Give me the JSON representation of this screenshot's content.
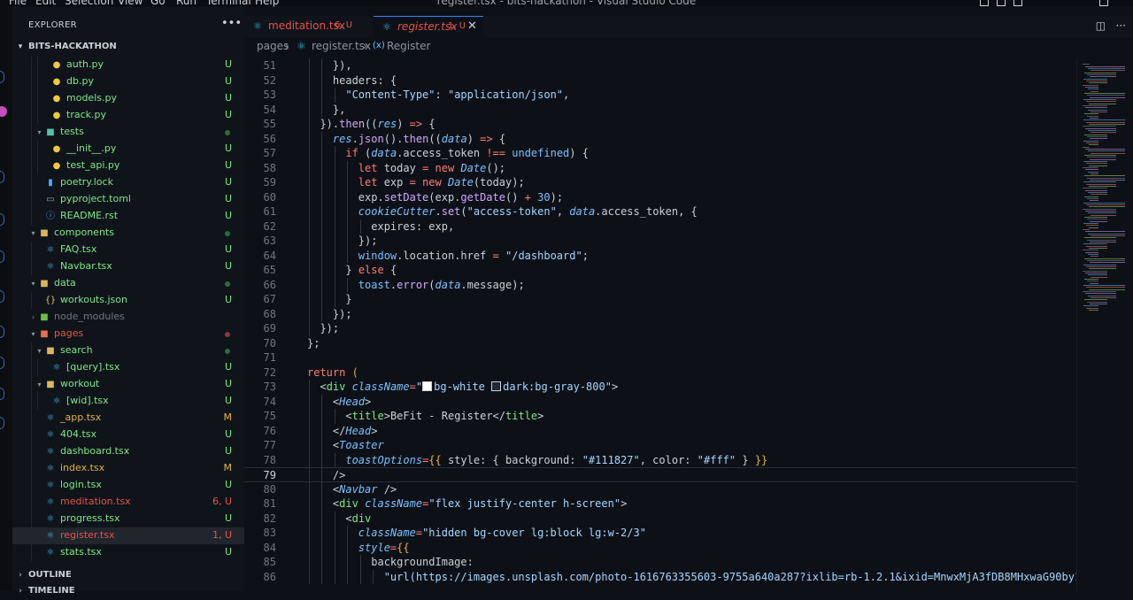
{
  "window": {
    "title": "register.tsx - bits-hackathon - Visual Studio Code",
    "menu": [
      "File",
      "Edit",
      "Selection",
      "View",
      "Go",
      "Run",
      "Terminal",
      "Help"
    ]
  },
  "activity": {
    "badge_color": "#c64ebc"
  },
  "sidebar": {
    "title": "EXPLORER",
    "more_icon": "ellipsis-icon",
    "root": "BITS-HACKATHON",
    "tree": [
      {
        "label": "auth.py",
        "icon": "python-icon",
        "depth": 3,
        "status": "U",
        "kind": "file"
      },
      {
        "label": "db.py",
        "icon": "python-icon",
        "depth": 3,
        "status": "U",
        "kind": "file"
      },
      {
        "label": "models.py",
        "icon": "python-icon",
        "depth": 3,
        "status": "U",
        "kind": "file"
      },
      {
        "label": "track.py",
        "icon": "python-icon",
        "depth": 3,
        "status": "U",
        "kind": "file"
      },
      {
        "label": "tests",
        "icon": "test-folder-icon",
        "depth": 2,
        "status": "dot",
        "kind": "folder-open"
      },
      {
        "label": "__init__.py",
        "icon": "python-icon",
        "depth": 3,
        "status": "U",
        "kind": "file"
      },
      {
        "label": "test_api.py",
        "icon": "python-icon",
        "depth": 3,
        "status": "U",
        "kind": "file"
      },
      {
        "label": "poetry.lock",
        "icon": "lock-icon",
        "depth": 2,
        "status": "U",
        "kind": "file"
      },
      {
        "label": "pyproject.toml",
        "icon": "toml-icon",
        "depth": 2,
        "status": "U",
        "kind": "file"
      },
      {
        "label": "README.rst",
        "icon": "info-icon",
        "depth": 2,
        "status": "U",
        "kind": "file"
      },
      {
        "label": "components",
        "icon": "folder-icon",
        "depth": 1,
        "status": "dot",
        "kind": "folder-open"
      },
      {
        "label": "FAQ.tsx",
        "icon": "react-icon",
        "depth": 2,
        "status": "U",
        "kind": "file"
      },
      {
        "label": "Navbar.tsx",
        "icon": "react-icon",
        "depth": 2,
        "status": "U",
        "kind": "file"
      },
      {
        "label": "data",
        "icon": "folder-icon",
        "depth": 1,
        "status": "dot",
        "kind": "folder-open"
      },
      {
        "label": "workouts.json",
        "icon": "json-icon",
        "depth": 2,
        "status": "U",
        "kind": "file"
      },
      {
        "label": "node_modules",
        "icon": "node-folder-icon",
        "depth": 1,
        "status": "",
        "kind": "folder-closed"
      },
      {
        "label": "pages",
        "icon": "pages-folder-icon",
        "depth": 1,
        "status": "dot-red",
        "kind": "folder-open"
      },
      {
        "label": "search",
        "icon": "folder-icon",
        "depth": 2,
        "status": "dot",
        "kind": "folder-open"
      },
      {
        "label": "[query].tsx",
        "icon": "react-icon",
        "depth": 3,
        "status": "U",
        "kind": "file"
      },
      {
        "label": "workout",
        "icon": "folder-icon",
        "depth": 2,
        "status": "U",
        "kind": "folder-open"
      },
      {
        "label": "[wid].tsx",
        "icon": "react-icon",
        "depth": 3,
        "status": "U",
        "kind": "file"
      },
      {
        "label": "_app.tsx",
        "icon": "react-icon",
        "depth": 2,
        "status": "M",
        "kind": "file"
      },
      {
        "label": "404.tsx",
        "icon": "react-icon",
        "depth": 2,
        "status": "U",
        "kind": "file"
      },
      {
        "label": "dashboard.tsx",
        "icon": "react-icon",
        "depth": 2,
        "status": "U",
        "kind": "file"
      },
      {
        "label": "index.tsx",
        "icon": "react-icon",
        "depth": 2,
        "status": "M",
        "kind": "file"
      },
      {
        "label": "login.tsx",
        "icon": "react-icon",
        "depth": 2,
        "status": "U",
        "kind": "file"
      },
      {
        "label": "meditation.tsx",
        "icon": "react-icon",
        "depth": 2,
        "status": "6, U",
        "kind": "file",
        "error": true
      },
      {
        "label": "progress.tsx",
        "icon": "react-icon",
        "depth": 2,
        "status": "U",
        "kind": "file"
      },
      {
        "label": "register.tsx",
        "icon": "react-icon",
        "depth": 2,
        "status": "1, U",
        "kind": "file",
        "error": true,
        "selected": true
      },
      {
        "label": "stats.tsx",
        "icon": "react-icon",
        "depth": 2,
        "status": "U",
        "kind": "file"
      }
    ],
    "outline": "OUTLINE",
    "timeline": "TIMELINE"
  },
  "tabs": [
    {
      "label": "meditation.tsx",
      "badge": "6, U",
      "active": false
    },
    {
      "label": "register.tsx",
      "badge": "1, U",
      "active": true
    }
  ],
  "breadcrumb": {
    "folder": "pages",
    "file": "register.tsx",
    "symbol": "Register",
    "sep": "›"
  },
  "code": {
    "current_line": 79,
    "lines": [
      {
        "n": 51,
        "indent": 2,
        "tokens": [
          [
            "p",
            "}),"
          ]
        ]
      },
      {
        "n": 52,
        "indent": 2,
        "tokens": [
          [
            "p",
            "headers: {"
          ]
        ]
      },
      {
        "n": 53,
        "indent": 3,
        "tokens": [
          [
            "s",
            "\"Content-Type\""
          ],
          [
            "p",
            ": "
          ],
          [
            "s",
            "\"application/json\""
          ],
          [
            "p",
            ","
          ]
        ]
      },
      {
        "n": 54,
        "indent": 2,
        "tokens": [
          [
            "p",
            "},"
          ]
        ]
      },
      {
        "n": 55,
        "indent": 1,
        "tokens": [
          [
            "p",
            "})."
          ],
          [
            "f",
            "then"
          ],
          [
            "p",
            "(("
          ],
          [
            "i",
            "res"
          ],
          [
            "p",
            ") "
          ],
          [
            "k",
            "=>"
          ],
          [
            "p",
            " {"
          ]
        ]
      },
      {
        "n": 56,
        "indent": 2,
        "tokens": [
          [
            "i",
            "res"
          ],
          [
            "p",
            "."
          ],
          [
            "f",
            "json"
          ],
          [
            "p",
            "()."
          ],
          [
            "f",
            "then"
          ],
          [
            "p",
            "(("
          ],
          [
            "i",
            "data"
          ],
          [
            "p",
            ") "
          ],
          [
            "k",
            "=>"
          ],
          [
            "p",
            " {"
          ]
        ]
      },
      {
        "n": 57,
        "indent": 3,
        "tokens": [
          [
            "k",
            "if"
          ],
          [
            "p",
            " ("
          ],
          [
            "i",
            "data"
          ],
          [
            "p",
            ".access_token "
          ],
          [
            "k",
            "!=="
          ],
          [
            "p",
            " "
          ],
          [
            "n",
            "undefined"
          ],
          [
            "p",
            ") {"
          ]
        ]
      },
      {
        "n": 58,
        "indent": 4,
        "tokens": [
          [
            "k",
            "let"
          ],
          [
            "p",
            " today "
          ],
          [
            "k",
            "="
          ],
          [
            "p",
            " "
          ],
          [
            "k",
            "new"
          ],
          [
            "p",
            " "
          ],
          [
            "i",
            "Date"
          ],
          [
            "p",
            "();"
          ]
        ]
      },
      {
        "n": 59,
        "indent": 4,
        "tokens": [
          [
            "k",
            "let"
          ],
          [
            "p",
            " exp "
          ],
          [
            "k",
            "="
          ],
          [
            "p",
            " "
          ],
          [
            "k",
            "new"
          ],
          [
            "p",
            " "
          ],
          [
            "i",
            "Date"
          ],
          [
            "p",
            "(today);"
          ]
        ]
      },
      {
        "n": 60,
        "indent": 4,
        "tokens": [
          [
            "p",
            "exp."
          ],
          [
            "f",
            "setDate"
          ],
          [
            "p",
            "(exp."
          ],
          [
            "f",
            "getDate"
          ],
          [
            "p",
            "() "
          ],
          [
            "k",
            "+"
          ],
          [
            "p",
            " "
          ],
          [
            "n",
            "30"
          ],
          [
            "p",
            ");"
          ]
        ]
      },
      {
        "n": 61,
        "indent": 4,
        "tokens": [
          [
            "i",
            "cookieCutter"
          ],
          [
            "p",
            "."
          ],
          [
            "f",
            "set"
          ],
          [
            "p",
            "("
          ],
          [
            "s",
            "\"access-token\""
          ],
          [
            "p",
            ", "
          ],
          [
            "i",
            "data"
          ],
          [
            "p",
            ".access_token, {"
          ]
        ]
      },
      {
        "n": 62,
        "indent": 5,
        "tokens": [
          [
            "p",
            "expires: exp,"
          ]
        ]
      },
      {
        "n": 63,
        "indent": 4,
        "tokens": [
          [
            "p",
            "});"
          ]
        ]
      },
      {
        "n": 64,
        "indent": 4,
        "tokens": [
          [
            "n",
            "window"
          ],
          [
            "p",
            ".location.href "
          ],
          [
            "k",
            "="
          ],
          [
            "p",
            " "
          ],
          [
            "s",
            "\"/dashboard\""
          ],
          [
            "p",
            ";"
          ]
        ]
      },
      {
        "n": 65,
        "indent": 3,
        "tokens": [
          [
            "p",
            "} "
          ],
          [
            "k",
            "else"
          ],
          [
            "p",
            " {"
          ]
        ]
      },
      {
        "n": 66,
        "indent": 4,
        "tokens": [
          [
            "n",
            "toast"
          ],
          [
            "p",
            "."
          ],
          [
            "f",
            "error"
          ],
          [
            "p",
            "("
          ],
          [
            "i",
            "data"
          ],
          [
            "p",
            ".message);"
          ]
        ]
      },
      {
        "n": 67,
        "indent": 3,
        "tokens": [
          [
            "p",
            "}"
          ]
        ]
      },
      {
        "n": 68,
        "indent": 2,
        "tokens": [
          [
            "p",
            "});"
          ]
        ]
      },
      {
        "n": 69,
        "indent": 1,
        "tokens": [
          [
            "p",
            "});"
          ]
        ]
      },
      {
        "n": 70,
        "indent": 0,
        "tokens": [
          [
            "p",
            "};"
          ]
        ]
      },
      {
        "n": 71,
        "indent": 0,
        "tokens": []
      },
      {
        "n": 72,
        "indent": 0,
        "tokens": [
          [
            "k",
            "return"
          ],
          [
            "p",
            " "
          ],
          [
            "b",
            "("
          ]
        ]
      },
      {
        "n": 73,
        "indent": 1,
        "tokens": [
          [
            "p",
            "<"
          ],
          [
            "t",
            "div"
          ],
          [
            "p",
            " "
          ],
          [
            "a",
            "className"
          ],
          [
            "k",
            "="
          ],
          [
            "s",
            "\""
          ],
          [
            "sw",
            "#ffffff"
          ],
          [
            "s",
            "bg-white "
          ],
          [
            "sw",
            "#1f2937"
          ],
          [
            "s",
            "dark:bg-gray-800\""
          ],
          [
            "p",
            ">"
          ]
        ]
      },
      {
        "n": 74,
        "indent": 2,
        "tokens": [
          [
            "p",
            "<"
          ],
          [
            "i",
            "Head"
          ],
          [
            "p",
            ">"
          ]
        ]
      },
      {
        "n": 75,
        "indent": 3,
        "tokens": [
          [
            "p",
            "<"
          ],
          [
            "t",
            "title"
          ],
          [
            "p",
            ">BeFit - Register</"
          ],
          [
            "t",
            "title"
          ],
          [
            "p",
            ">"
          ]
        ]
      },
      {
        "n": 76,
        "indent": 2,
        "tokens": [
          [
            "p",
            "</"
          ],
          [
            "i",
            "Head"
          ],
          [
            "p",
            ">"
          ]
        ]
      },
      {
        "n": 77,
        "indent": 2,
        "tokens": [
          [
            "p",
            "<"
          ],
          [
            "i",
            "Toaster"
          ]
        ]
      },
      {
        "n": 78,
        "indent": 3,
        "tokens": [
          [
            "a",
            "toastOptions"
          ],
          [
            "k",
            "="
          ],
          [
            "b",
            "{{"
          ],
          [
            "p",
            " style: { background: "
          ],
          [
            "s",
            "\"#111827\""
          ],
          [
            "p",
            ", color: "
          ],
          [
            "s",
            "\"#fff\""
          ],
          [
            "p",
            " } "
          ],
          [
            "b",
            "}}"
          ]
        ]
      },
      {
        "n": 79,
        "indent": 2,
        "tokens": [
          [
            "p",
            "/>"
          ]
        ]
      },
      {
        "n": 80,
        "indent": 2,
        "tokens": [
          [
            "p",
            "<"
          ],
          [
            "i",
            "Navbar"
          ],
          [
            "p",
            " />"
          ]
        ]
      },
      {
        "n": 81,
        "indent": 2,
        "tokens": [
          [
            "p",
            "<"
          ],
          [
            "t",
            "div"
          ],
          [
            "p",
            " "
          ],
          [
            "a",
            "className"
          ],
          [
            "k",
            "="
          ],
          [
            "s",
            "\"flex justify-center h-screen\""
          ],
          [
            "p",
            ">"
          ]
        ]
      },
      {
        "n": 82,
        "indent": 3,
        "tokens": [
          [
            "p",
            "<"
          ],
          [
            "t",
            "div"
          ]
        ]
      },
      {
        "n": 83,
        "indent": 4,
        "tokens": [
          [
            "a",
            "className"
          ],
          [
            "k",
            "="
          ],
          [
            "s",
            "\"hidden bg-cover lg:block lg:w-2/3\""
          ]
        ]
      },
      {
        "n": 84,
        "indent": 4,
        "tokens": [
          [
            "a",
            "style"
          ],
          [
            "k",
            "="
          ],
          [
            "b",
            "{{"
          ]
        ]
      },
      {
        "n": 85,
        "indent": 5,
        "tokens": [
          [
            "p",
            "backgroundImage:"
          ]
        ]
      },
      {
        "n": 86,
        "indent": 6,
        "tokens": [
          [
            "s",
            "\"url(https://images.unsplash.com/photo-1616763355603-9755a640a287?ixlib=rb-1.2.1&ixid=MnwxMjA3fDB8MHxwaG90by1wYWdlfHx"
          ]
        ]
      }
    ]
  }
}
